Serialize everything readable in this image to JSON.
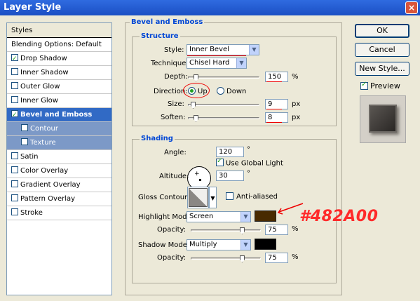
{
  "window": {
    "title": "Layer Style",
    "close_glyph": "×"
  },
  "styles_list": {
    "header": "Styles",
    "items": [
      {
        "label": "Blending Options: Default",
        "checkbox": false,
        "checked": false,
        "state": "normal"
      },
      {
        "label": "Drop Shadow",
        "checkbox": true,
        "checked": true,
        "state": "normal"
      },
      {
        "label": "Inner Shadow",
        "checkbox": true,
        "checked": false,
        "state": "normal"
      },
      {
        "label": "Outer Glow",
        "checkbox": true,
        "checked": false,
        "state": "normal"
      },
      {
        "label": "Inner Glow",
        "checkbox": true,
        "checked": false,
        "state": "normal"
      },
      {
        "label": "Bevel and Emboss",
        "checkbox": true,
        "checked": true,
        "state": "selected"
      },
      {
        "label": "Contour",
        "checkbox": true,
        "checked": false,
        "state": "sub"
      },
      {
        "label": "Texture",
        "checkbox": true,
        "checked": false,
        "state": "sub"
      },
      {
        "label": "Satin",
        "checkbox": true,
        "checked": false,
        "state": "normal"
      },
      {
        "label": "Color Overlay",
        "checkbox": true,
        "checked": false,
        "state": "normal"
      },
      {
        "label": "Gradient Overlay",
        "checkbox": true,
        "checked": false,
        "state": "normal"
      },
      {
        "label": "Pattern Overlay",
        "checkbox": true,
        "checked": false,
        "state": "normal"
      },
      {
        "label": "Stroke",
        "checkbox": true,
        "checked": false,
        "state": "normal"
      }
    ]
  },
  "buttons": {
    "ok": "OK",
    "cancel": "Cancel",
    "new_style": "New Style...",
    "preview_label": "Preview",
    "preview_checked": true
  },
  "bevel": {
    "group_title": "Bevel and Emboss",
    "structure": {
      "title": "Structure",
      "style_label": "Style:",
      "style_value": "Inner Bevel",
      "technique_label": "Technique:",
      "technique_value": "Chisel Hard",
      "depth_label": "Depth:",
      "depth_value": "150",
      "depth_unit": "%",
      "depth_level": 0.08,
      "direction_label": "Direction:",
      "dir_up": "Up",
      "dir_down": "Down",
      "direction_selected": "Up",
      "size_label": "Size:",
      "size_value": "9",
      "size_unit": "px",
      "size_level": 0.04,
      "soften_label": "Soften:",
      "soften_value": "8",
      "soften_unit": "px",
      "soften_level": 0.08
    },
    "shading": {
      "title": "Shading",
      "angle_label": "Angle:",
      "angle_value": "120",
      "angle_unit": "°",
      "use_global_light": "Use Global Light",
      "use_global_light_checked": true,
      "altitude_label": "Altitude:",
      "altitude_value": "30",
      "altitude_unit": "°",
      "gloss_contour_label": "Gloss Contour:",
      "anti_aliased": "Anti-aliased",
      "anti_aliased_checked": false,
      "highlight_mode_label": "Highlight Mode:",
      "highlight_mode_value": "Screen",
      "highlight_color": "#482A00",
      "opacity_label": "Opacity:",
      "highlight_opacity": "75",
      "opacity_unit": "%",
      "highlight_opacity_level": 0.75,
      "shadow_mode_label": "Shadow Mode:",
      "shadow_mode_value": "Multiply",
      "shadow_color": "#000000",
      "shadow_opacity": "75",
      "shadow_opacity_level": 0.75
    }
  },
  "annotation": {
    "text": "#482A00",
    "color": "#ff2a2a"
  }
}
